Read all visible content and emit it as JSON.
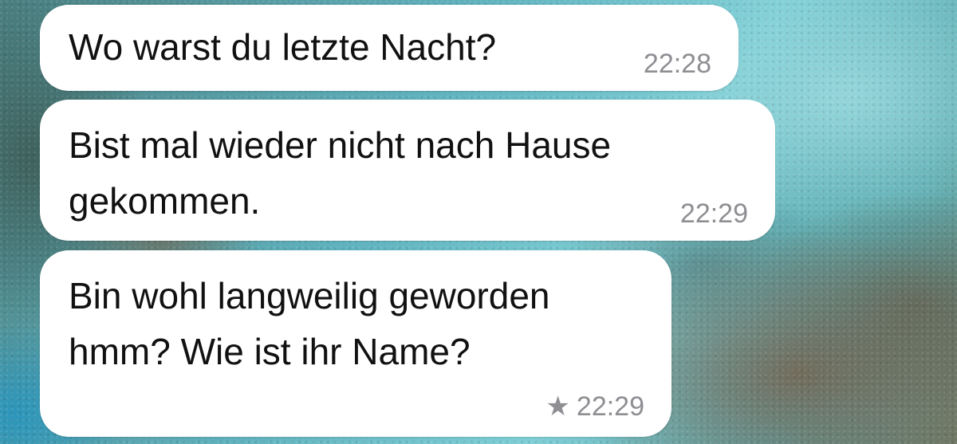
{
  "messages": [
    {
      "text": "Wo warst du letzte Nacht?",
      "time": "22:28",
      "starred": false
    },
    {
      "text": "Bist mal wieder nicht nach Hause\ngekommen.",
      "time": "22:29",
      "starred": false
    },
    {
      "text": "Bin wohl langweilig geworden\nhmm? Wie ist ihr Name?",
      "time": "22:29",
      "starred": true,
      "star_glyph": "★"
    }
  ],
  "colors": {
    "bubble": "#ffffff",
    "text": "#111111",
    "timestamp": "#8e8e93"
  }
}
